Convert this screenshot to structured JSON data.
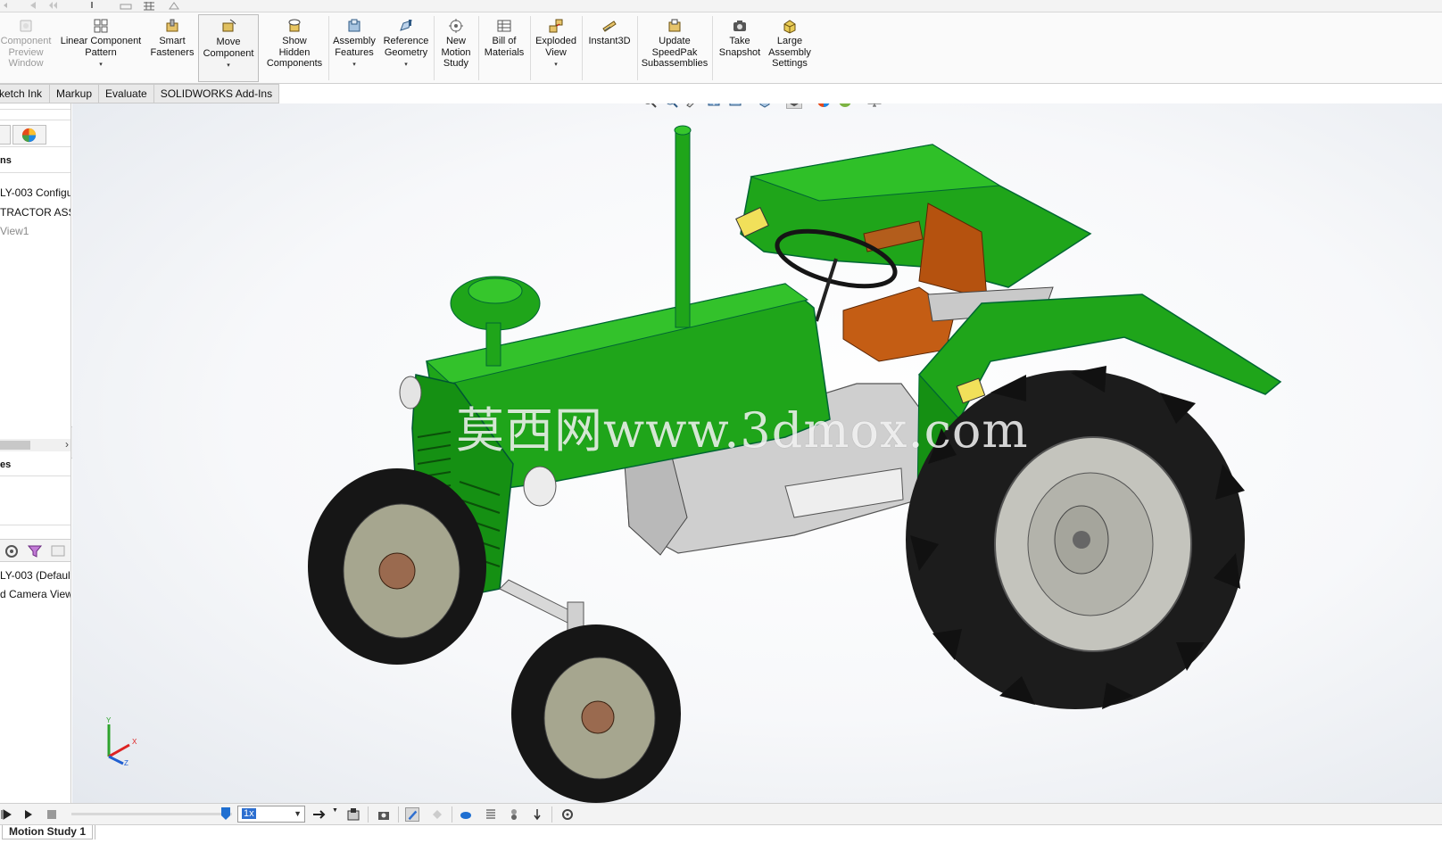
{
  "ribbon": {
    "buttons": [
      {
        "id": "component-preview",
        "label": "Component\nPreview\nWindow",
        "disabled": true
      },
      {
        "id": "linear-pattern",
        "label": "Linear Component\nPattern",
        "dropdown": "▾"
      },
      {
        "id": "smart-fasteners",
        "label": "Smart\nFasteners"
      },
      {
        "id": "move-component",
        "label": "Move\nComponent",
        "dropdown": "▾"
      },
      {
        "id": "show-hidden",
        "label": "Show\nHidden\nComponents"
      },
      {
        "id": "assembly-features",
        "label": "Assembly\nFeatures",
        "dropdown": "▾"
      },
      {
        "id": "reference-geometry",
        "label": "Reference\nGeometry",
        "dropdown": "▾"
      },
      {
        "id": "new-motion-study",
        "label": "New\nMotion\nStudy"
      },
      {
        "id": "bill-of-materials",
        "label": "Bill of\nMaterials"
      },
      {
        "id": "exploded-view",
        "label": "Exploded\nView",
        "dropdown": "▾"
      },
      {
        "id": "instant3d",
        "label": "Instant3D"
      },
      {
        "id": "update-speedpak",
        "label": "Update\nSpeedPak\nSubassemblies"
      },
      {
        "id": "take-snapshot",
        "label": "Take\nSnapshot"
      },
      {
        "id": "large-assembly",
        "label": "Large\nAssembly\nSettings"
      }
    ]
  },
  "tabs": [
    "Sketch Ink",
    "Markup",
    "Evaluate",
    "SOLIDWORKS Add-Ins"
  ],
  "tree": {
    "section1": "ns",
    "items": [
      "LY-003 Configu",
      "TRACTOR ASSEN",
      "View1"
    ],
    "section2": "es",
    "bottom_items": [
      "LY-003  (Default",
      "d Camera Views"
    ]
  },
  "watermark": "莫西网www.3dmox.com",
  "motion": {
    "speed": "1x",
    "study_tab": "Motion Study 1"
  },
  "axes": {
    "y": "Y",
    "x": "X",
    "z": "Z"
  },
  "colors": {
    "tractor_green": "#1fa51a",
    "seat": "#b5520f",
    "tire": "#1c1c1c",
    "rim": "#c4c4bd",
    "engine_grey": "#cfcfcf",
    "accent_blue": "#1f6fd1"
  }
}
